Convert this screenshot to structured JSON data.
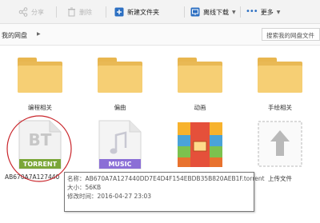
{
  "toolbar": {
    "share_label": "分享",
    "delete_label": "删除",
    "new_folder_label": "新建文件夹",
    "offline_download_label": "离线下载",
    "more_label": "更多"
  },
  "address": {
    "breadcrumb": "我的网盘",
    "search_placeholder": "搜索我的网盘文件"
  },
  "files": [
    {
      "name": "编程相关",
      "type": "folder"
    },
    {
      "name": "偏曲",
      "type": "folder"
    },
    {
      "name": "动画",
      "type": "folder"
    },
    {
      "name": "手绘相关",
      "type": "folder"
    },
    {
      "name": "AB670A7A127440",
      "type": "torrent",
      "badge": "TORRENT",
      "glyph": "BT"
    },
    {
      "name": "",
      "type": "music",
      "badge": "MUSIC"
    },
    {
      "name": "",
      "type": "archive"
    },
    {
      "name": "上传文件",
      "type": "upload"
    }
  ],
  "tooltip": {
    "name_line": "名称：AB670A7A127440DD7E4D4F154EBDB35B820AEB1F.torrent",
    "size_line": "大小：56KB",
    "mtime_line": "修改时间：2016-04-27 23:03"
  },
  "colors": {
    "folder": "#f6cf74",
    "torrent_badge": "#7aa638",
    "music_badge": "#8b6fd6",
    "highlight_circle": "#c9252b"
  }
}
